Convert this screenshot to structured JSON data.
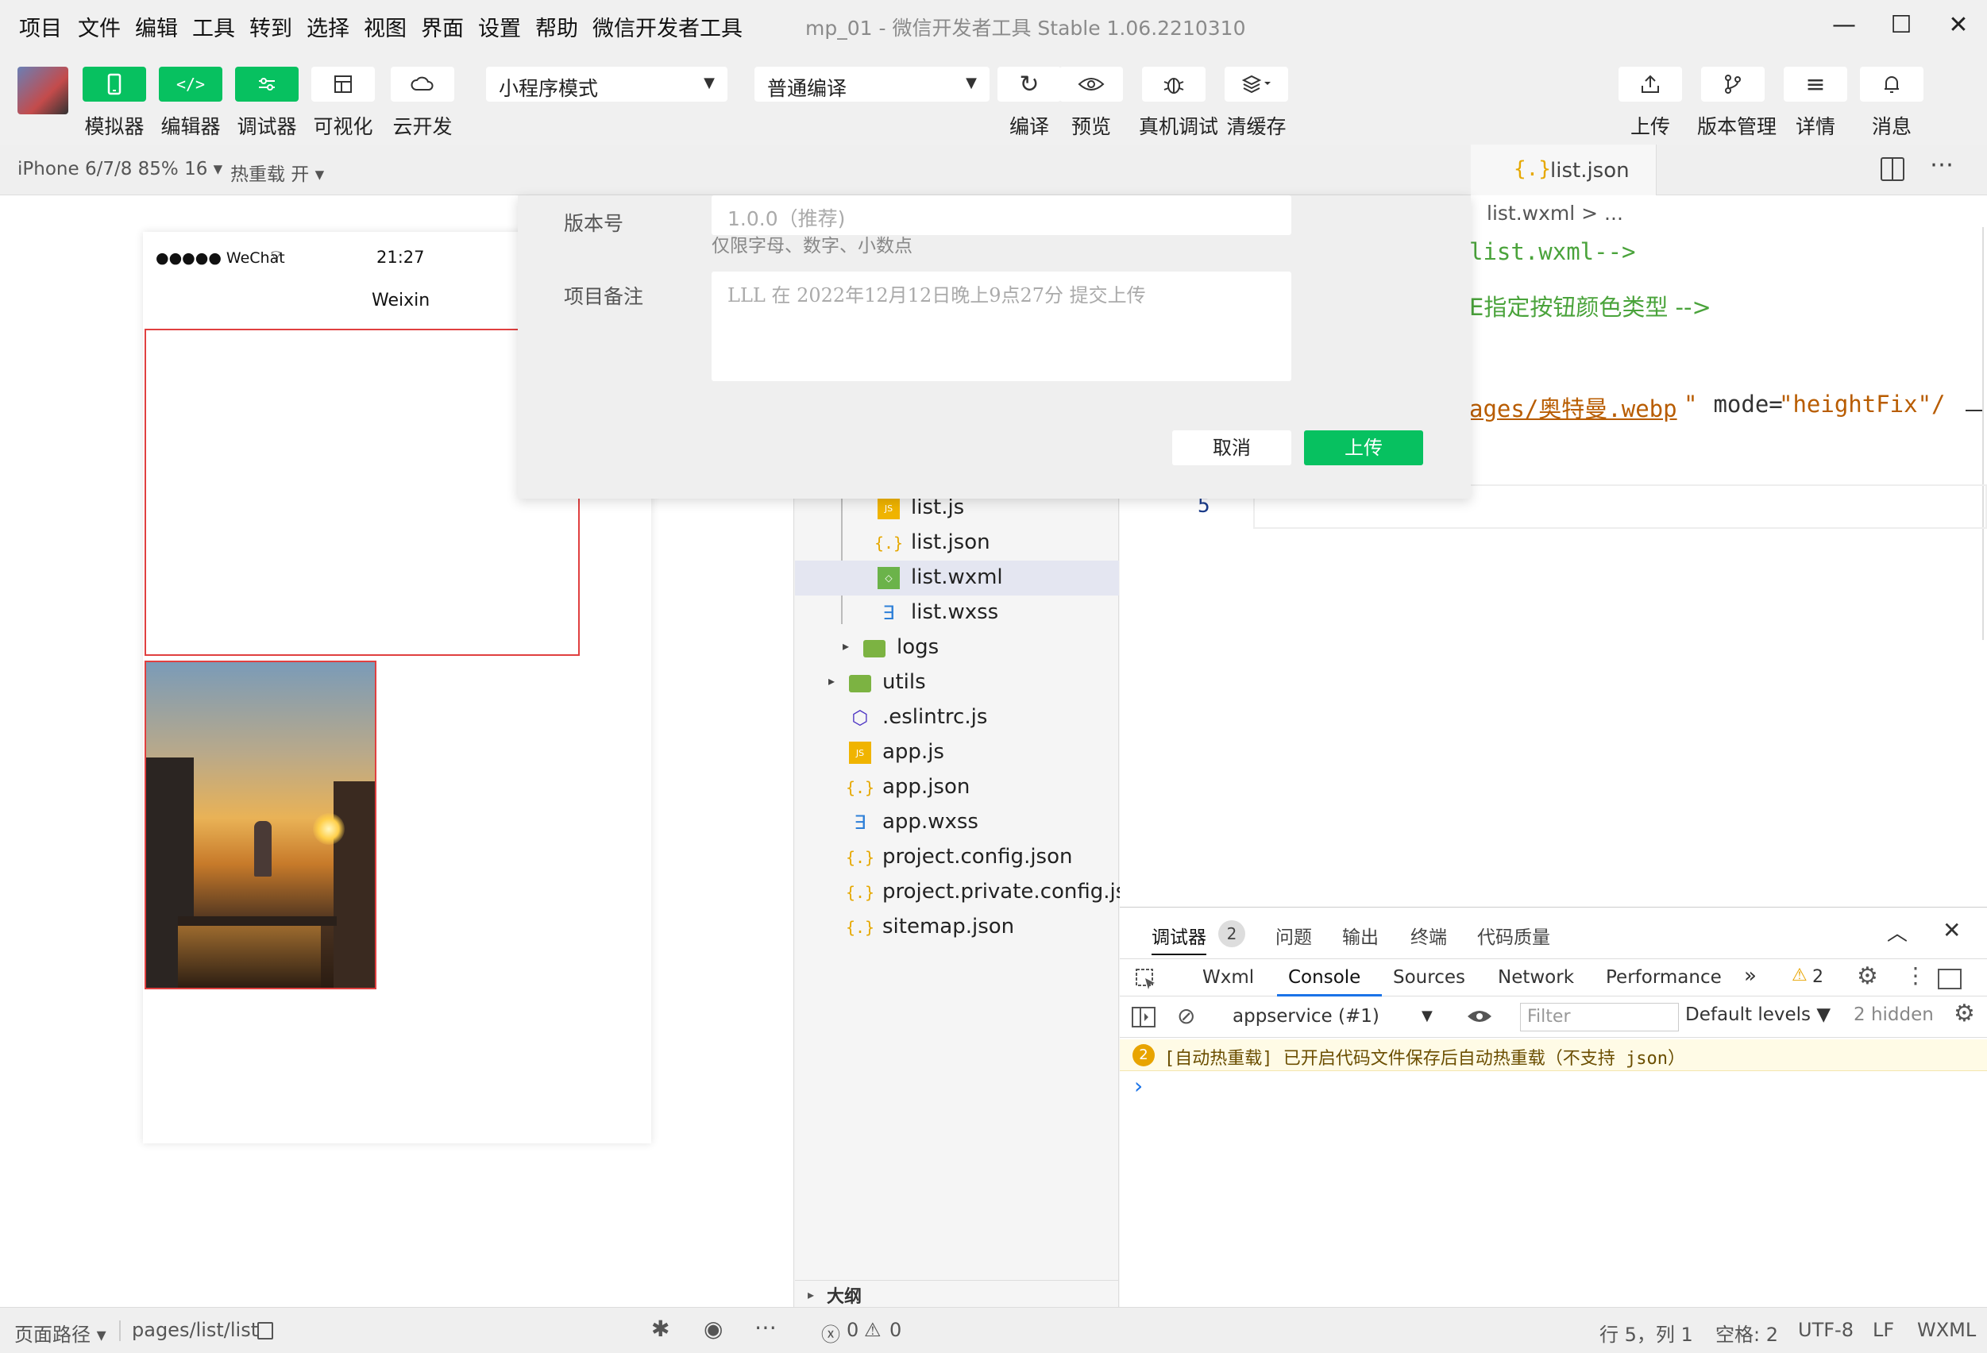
{
  "menubar": {
    "items": [
      "项目",
      "文件",
      "编辑",
      "工具",
      "转到",
      "选择",
      "视图",
      "界面",
      "设置",
      "帮助",
      "微信开发者工具"
    ],
    "title": "mp_01 - 微信开发者工具 Stable 1.06.2210310",
    "controls": [
      "—",
      "☐",
      "✕"
    ]
  },
  "toolbar": {
    "left_buttons": [
      {
        "label": "模拟器",
        "icon": "phone-icon"
      },
      {
        "label": "编辑器",
        "icon": "code-icon"
      },
      {
        "label": "调试器",
        "icon": "debug-sliders-icon"
      },
      {
        "label": "可视化",
        "icon": "layout-icon"
      },
      {
        "label": "云开发",
        "icon": "cloud-icon"
      }
    ],
    "mode_select": "小程序模式",
    "compile_select": "普通编译",
    "mid_buttons": [
      {
        "label": "编译",
        "icon": "refresh-icon"
      },
      {
        "label": "预览",
        "icon": "eye-icon"
      },
      {
        "label": "真机调试",
        "icon": "bug-icon"
      },
      {
        "label": "清缓存",
        "icon": "layers-icon"
      }
    ],
    "right_buttons": [
      {
        "label": "上传",
        "icon": "upload-icon"
      },
      {
        "label": "版本管理",
        "icon": "branch-icon"
      },
      {
        "label": "详情",
        "icon": "menu-icon"
      },
      {
        "label": "消息",
        "icon": "bell-icon"
      }
    ]
  },
  "subbar": {
    "device": "iPhone 6/7/8 85% 16",
    "hot_reload": "热重载 开",
    "tab": "list.json"
  },
  "phone": {
    "carrier": "●●●●● WeChat",
    "time": "21:27",
    "nav_title": "Weixin"
  },
  "dialog": {
    "version_label": "版本号",
    "version_placeholder": "1.0.0（推荐)",
    "version_hint": "仅限字母、数字、小数点",
    "note_label": "项目备注",
    "note_placeholder": "LLL 在 2022年12月12日晚上9点27分 提交上传",
    "cancel": "取消",
    "upload": "上传"
  },
  "filetree": {
    "items": [
      {
        "name": "list.js",
        "icon": "js-file-icon",
        "indent": 2,
        "color": "#f0b400"
      },
      {
        "name": "list.json",
        "icon": "json-file-icon",
        "indent": 2,
        "color": "#e6a800"
      },
      {
        "name": "list.wxml",
        "icon": "wxml-file-icon",
        "indent": 2,
        "color": "#6bb34a",
        "selected": true
      },
      {
        "name": "list.wxss",
        "icon": "wxss-file-icon",
        "indent": 2,
        "color": "#2d7fd8"
      },
      {
        "name": "logs",
        "icon": "folder-icon",
        "indent": 1,
        "color": "#7cb342",
        "arrow": "▸"
      },
      {
        "name": "utils",
        "icon": "folder-icon",
        "indent": 0,
        "color": "#7cb342",
        "arrow": "▸"
      },
      {
        "name": ".eslintrc.js",
        "icon": "eslint-icon",
        "indent": 0,
        "color": "#4b32c3"
      },
      {
        "name": "app.js",
        "icon": "js-file-icon",
        "indent": 0,
        "color": "#f0b400"
      },
      {
        "name": "app.json",
        "icon": "json-file-icon",
        "indent": 0,
        "color": "#e6a800"
      },
      {
        "name": "app.wxss",
        "icon": "wxss-file-icon",
        "indent": 0,
        "color": "#2d7fd8"
      },
      {
        "name": "project.config.json",
        "icon": "json-file-icon",
        "indent": 0,
        "color": "#e6a800"
      },
      {
        "name": "project.private.config.js...",
        "icon": "json-file-icon",
        "indent": 0,
        "color": "#e6a800"
      },
      {
        "name": "sitemap.json",
        "icon": "json-file-icon",
        "indent": 0,
        "color": "#e6a800"
      }
    ],
    "outline": "大纲"
  },
  "editor": {
    "breadcrumb": "list.wxml > ...",
    "line1": "list.wxml-->",
    "line2": "E指定按钮颜色类型 -->",
    "line3_path": "ages/奥特曼.webp",
    "line3_attr": " mode=",
    "line3_val": "\"heightFix\"/",
    "line_number": "5"
  },
  "debugger": {
    "tabs": [
      "调试器",
      "问题",
      "输出",
      "终端",
      "代码质量"
    ],
    "badge": "2",
    "devtabs": [
      "Wxml",
      "Console",
      "Sources",
      "Network",
      "Performance"
    ],
    "warn_count": "2",
    "context": "appservice (#1)",
    "filter": "Filter",
    "levels": "Default levels",
    "hidden": "2 hidden",
    "message_badge": "2",
    "message": "[自动热重载] 已开启代码文件保存后自动热重载（不支持 json）",
    "prompt": "›"
  },
  "statusbar": {
    "path_label": "页面路径",
    "path": "pages/list/list",
    "errors": "0",
    "warnings": "0",
    "position": "行 5，列 1",
    "spaces": "空格: 2",
    "encoding": "UTF-8",
    "eol": "LF",
    "lang": "WXML"
  }
}
